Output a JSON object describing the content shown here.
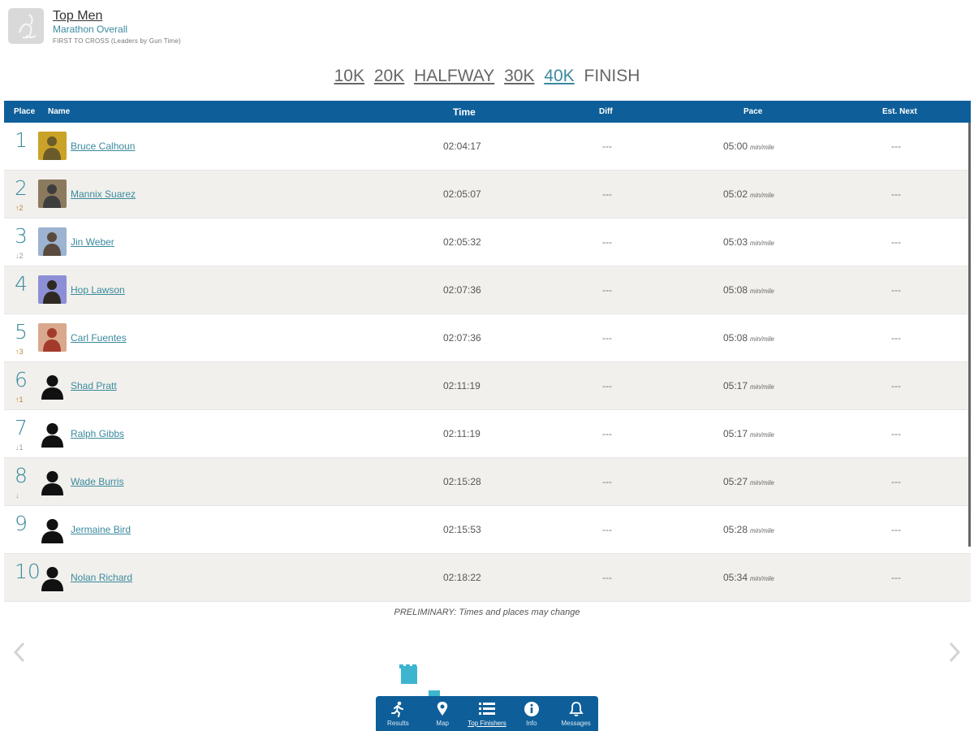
{
  "header": {
    "title": "Top Men",
    "subtitle": "Marathon Overall",
    "note": "FIRST TO CROSS (Leaders by Gun Time)"
  },
  "splits": [
    {
      "label": "10K",
      "state": "link"
    },
    {
      "label": "20K",
      "state": "link"
    },
    {
      "label": "HALFWAY",
      "state": "link"
    },
    {
      "label": "30K",
      "state": "link"
    },
    {
      "label": "40K",
      "state": "active"
    },
    {
      "label": "FINISH",
      "state": "plain"
    }
  ],
  "table": {
    "columns": {
      "place": "Place",
      "name": "Name",
      "time": "Time",
      "diff": "Diff",
      "pace": "Pace",
      "est": "Est. Next"
    },
    "pace_unit": "min/mile",
    "rows": [
      {
        "place": "1",
        "move": "",
        "name": "Bruce Calhoun",
        "time": "02:04:17",
        "diff": "---",
        "pace": "05:00",
        "est": "---",
        "avatar": "photo-yellow"
      },
      {
        "place": "2",
        "move": "↑2",
        "name": "Mannix Suarez",
        "time": "02:05:07",
        "diff": "---",
        "pace": "05:02",
        "est": "---",
        "avatar": "photo-dark"
      },
      {
        "place": "3",
        "move": "↓2",
        "name": "Jin Weber",
        "time": "02:05:32",
        "diff": "---",
        "pace": "05:03",
        "est": "---",
        "avatar": "photo-blue"
      },
      {
        "place": "4",
        "move": "",
        "name": "Hop Lawson",
        "time": "02:07:36",
        "diff": "---",
        "pace": "05:08",
        "est": "---",
        "avatar": "photo-purple"
      },
      {
        "place": "5",
        "move": "↑3",
        "name": "Carl Fuentes",
        "time": "02:07:36",
        "diff": "---",
        "pace": "05:08",
        "est": "---",
        "avatar": "photo-red"
      },
      {
        "place": "6",
        "move": "↑1",
        "name": "Shad Pratt",
        "time": "02:11:19",
        "diff": "---",
        "pace": "05:17",
        "est": "---",
        "avatar": "silhouette"
      },
      {
        "place": "7",
        "move": "↓1",
        "name": "Ralph Gibbs",
        "time": "02:11:19",
        "diff": "---",
        "pace": "05:17",
        "est": "---",
        "avatar": "silhouette"
      },
      {
        "place": "8",
        "move": "↓",
        "name": "Wade Burris",
        "time": "02:15:28",
        "diff": "---",
        "pace": "05:27",
        "est": "---",
        "avatar": "silhouette"
      },
      {
        "place": "9",
        "move": "",
        "name": "Jermaine Bird",
        "time": "02:15:53",
        "diff": "---",
        "pace": "05:28",
        "est": "---",
        "avatar": "silhouette"
      },
      {
        "place": "10",
        "move": "",
        "name": "Nolan Richard",
        "time": "02:18:22",
        "diff": "---",
        "pace": "05:34",
        "est": "---",
        "avatar": "silhouette"
      }
    ]
  },
  "footer_note": "PRELIMINARY: Times and places may change",
  "nav": {
    "prev_icon": "chevron-left-icon",
    "next_icon": "chevron-right-icon",
    "tabs": [
      {
        "label": "Results",
        "icon": "runner-icon",
        "active": false
      },
      {
        "label": "Map",
        "icon": "map-pin-icon",
        "active": false
      },
      {
        "label": "Top Finishers",
        "icon": "list-icon",
        "active": true
      },
      {
        "label": "Info",
        "icon": "info-icon",
        "active": false
      },
      {
        "label": "Messages",
        "icon": "bell-icon",
        "active": false
      }
    ]
  },
  "colors": {
    "accent": "#3a8a9e",
    "header_bar": "#0e5f99",
    "alt_row": "#f1f0ec"
  }
}
